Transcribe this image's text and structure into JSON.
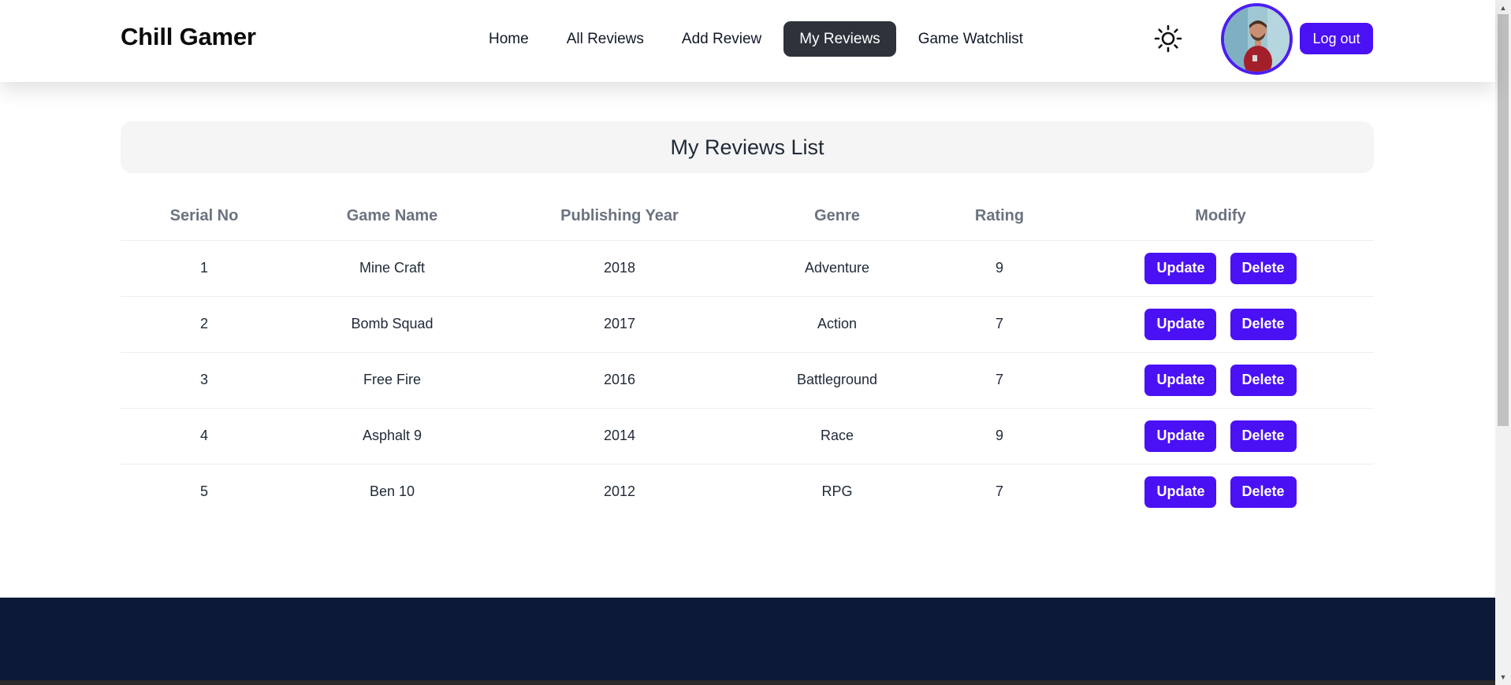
{
  "navbar": {
    "brand": "Chill Gamer",
    "links": [
      {
        "label": "Home",
        "active": false
      },
      {
        "label": "All Reviews",
        "active": false
      },
      {
        "label": "Add Review",
        "active": false
      },
      {
        "label": "My Reviews",
        "active": true
      },
      {
        "label": "Game Watchlist",
        "active": false
      }
    ],
    "theme_icon": "sun-icon",
    "logout_label": "Log out"
  },
  "main": {
    "title": "My Reviews List",
    "columns": [
      "Serial No",
      "Game Name",
      "Publishing Year",
      "Genre",
      "Rating",
      "Modify"
    ],
    "rows": [
      {
        "serial": "1",
        "name": "Mine Craft",
        "year": "2018",
        "genre": "Adventure",
        "rating": "9"
      },
      {
        "serial": "2",
        "name": "Bomb Squad",
        "year": "2017",
        "genre": "Action",
        "rating": "7"
      },
      {
        "serial": "3",
        "name": "Free Fire",
        "year": "2016",
        "genre": "Battleground",
        "rating": "7"
      },
      {
        "serial": "4",
        "name": "Asphalt 9",
        "year": "2014",
        "genre": "Race",
        "rating": "9"
      },
      {
        "serial": "5",
        "name": "Ben 10",
        "year": "2012",
        "genre": "RPG",
        "rating": "7"
      }
    ],
    "update_label": "Update",
    "delete_label": "Delete"
  },
  "colors": {
    "accent": "#4b11f5",
    "active_nav": "#2d323b",
    "footer": "#0c1936"
  }
}
